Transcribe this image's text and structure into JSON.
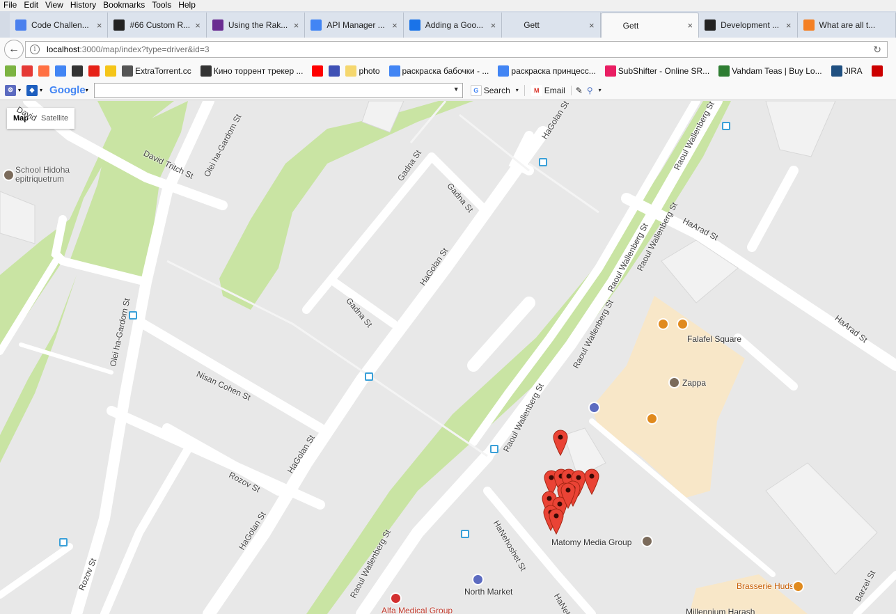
{
  "menubar": [
    "File",
    "Edit",
    "View",
    "History",
    "Bookmarks",
    "Tools",
    "Help"
  ],
  "tabs": [
    {
      "label": "Code Challen...",
      "icon": "docs-icon",
      "color": "#4a80ee",
      "active": false
    },
    {
      "label": "#66 Custom R...",
      "icon": "railscasts-icon",
      "color": "#222222",
      "active": false
    },
    {
      "label": "Using the Rak...",
      "icon": "yahoo-icon",
      "color": "#6a2c91",
      "active": false
    },
    {
      "label": "API Manager ...",
      "icon": "google-icon",
      "color": "#4285f4",
      "active": false
    },
    {
      "label": "Adding a Goo...",
      "icon": "chrome-icon",
      "color": "#1a73e8",
      "active": false
    },
    {
      "label": "Gett",
      "icon": "blank-icon",
      "color": "#dce3ed",
      "active": false
    },
    {
      "label": "Gett",
      "icon": "blank-icon",
      "color": "#f9f9f9",
      "active": true
    },
    {
      "label": "Development ...",
      "icon": "github-icon",
      "color": "#222222",
      "active": false
    },
    {
      "label": "What are all t...",
      "icon": "stackoverflow-icon",
      "color": "#f48024",
      "active": false
    }
  ],
  "url": {
    "host": "localhost",
    "rest": ":3000/map/index?type=driver&id=3"
  },
  "bookmarks": [
    {
      "label": "",
      "icon": "m-icon",
      "color": "#7cb342"
    },
    {
      "label": "",
      "icon": "yandex-icon",
      "color": "#e53935"
    },
    {
      "label": "",
      "icon": "a-icon",
      "color": "#ff7043"
    },
    {
      "label": "",
      "icon": "google-icon",
      "color": "#4285f4"
    },
    {
      "label": "",
      "icon": "xo-icon",
      "color": "#333333"
    },
    {
      "label": "",
      "icon": "youtube-icon",
      "color": "#e62117"
    },
    {
      "label": "",
      "icon": "imdb-icon",
      "color": "#f5c518"
    },
    {
      "label": "ExtraTorrent.cc",
      "icon": "extratorrent-icon",
      "color": "#555555"
    },
    {
      "label": "Кино торрент трекер ...",
      "icon": "film-icon",
      "color": "#333333"
    },
    {
      "label": "",
      "icon": "ya-icon",
      "color": "#ff0000"
    },
    {
      "label": "",
      "icon": "bag-icon",
      "color": "#3f51b5"
    },
    {
      "label": "photo",
      "icon": "folder-icon",
      "color": "#f5d76e"
    },
    {
      "label": "раскраска бабочки - ...",
      "icon": "google-icon",
      "color": "#4285f4"
    },
    {
      "label": "раскраска принцесс...",
      "icon": "google-icon",
      "color": "#4285f4"
    },
    {
      "label": "SubShifter - Online SR...",
      "icon": "subshifter-icon",
      "color": "#e91e63"
    },
    {
      "label": "Vahdam Teas | Buy Lo...",
      "icon": "leaf-icon",
      "color": "#2e7d32"
    },
    {
      "label": "JIRA",
      "icon": "jira-icon",
      "color": "#205081"
    },
    {
      "label": "",
      "icon": "flag-icon",
      "color": "#cc0000"
    }
  ],
  "googlebar": {
    "logo": "Google",
    "search_label": "Search",
    "email_label": "Email"
  },
  "map": {
    "type_buttons": [
      "Map",
      "Satellite"
    ],
    "streets": [
      "David Tritch St",
      "David",
      "Olei ha-Gardom St",
      "Gadna St",
      "Gadna St",
      "Gadna St",
      "HaGolan St",
      "HaGolan St",
      "HaGolan St",
      "HaGolan St",
      "Raoul Wallenberg St",
      "Raoul Wallenberg St",
      "Raoul Wallenberg St",
      "Raoul Wallenberg St",
      "Raoul Wallenberg St",
      "Raoul Wallenberg St",
      "HaArad St",
      "HaArad St",
      "Nisan Cohen St",
      "Olei ha-Gardom St",
      "Rozov St",
      "Rozov St",
      "HaNehoshet St",
      "HaNehos",
      "Barzel St"
    ],
    "places": [
      "School Hidoha epitriquetrum",
      "Falafel Square",
      "Zappa",
      "Matomy Media Group",
      "North Market",
      "Alfa Medical Group",
      "Brasserie Hudson",
      "Millennium Harash"
    ],
    "marker_count": 13
  }
}
